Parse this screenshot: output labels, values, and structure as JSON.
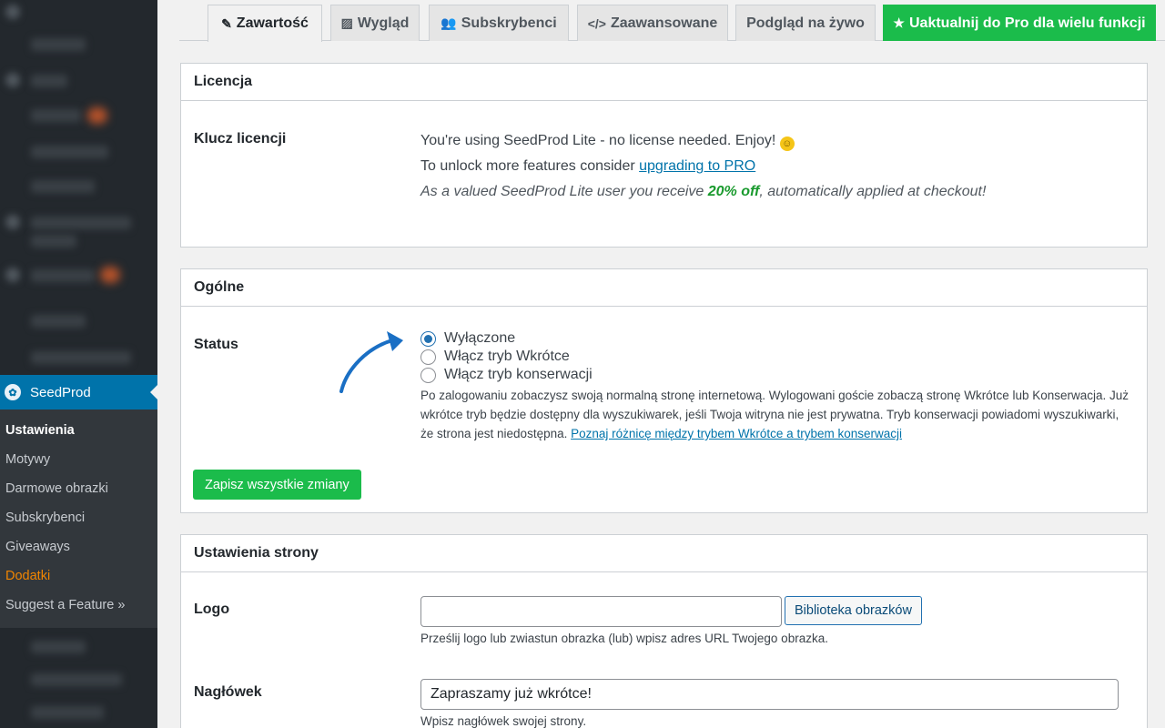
{
  "sidebar": {
    "plugin_name": "SeedProd",
    "submenu": [
      {
        "label": "Ustawienia"
      },
      {
        "label": "Motywy"
      },
      {
        "label": "Darmowe obrazki"
      },
      {
        "label": "Subskrybenci"
      },
      {
        "label": "Giveaways"
      },
      {
        "label": "Dodatki"
      },
      {
        "label": "Suggest a Feature »"
      }
    ]
  },
  "tabs": [
    {
      "label": "Zawartość",
      "icon": "edit-icon"
    },
    {
      "label": "Wygląd",
      "icon": "image-icon"
    },
    {
      "label": "Subskrybenci",
      "icon": "users-icon"
    },
    {
      "label": "Zaawansowane",
      "icon": "code-icon"
    },
    {
      "label": "Podgląd na żywo"
    },
    {
      "label": "Uaktualnij do Pro dla wielu funkcji",
      "icon": "star-icon"
    }
  ],
  "license": {
    "heading": "Licencja",
    "label": "Klucz licencji",
    "line1": "You're using SeedProd Lite - no license needed. Enjoy!",
    "line2_prefix": "To unlock more features consider ",
    "line2_link": "upgrading to PRO",
    "line3_prefix": "As a valued SeedProd Lite user you receive ",
    "line3_highlight": "20% off",
    "line3_suffix": ", automatically applied at checkout!"
  },
  "general": {
    "heading": "Ogólne",
    "status_label": "Status",
    "options": [
      {
        "label": "Wyłączone",
        "selected": true
      },
      {
        "label": "Włącz tryb Wkrótce",
        "selected": false
      },
      {
        "label": "Włącz tryb konserwacji",
        "selected": false
      }
    ],
    "description": "Po zalogowaniu zobaczysz swoją normalną stronę internetową. Wylogowani goście zobaczą stronę Wkrótce lub Konserwacja. Już wkrótce tryb będzie dostępny dla wyszukiwarek, jeśli Twoja witryna nie jest prywatna. Tryb konserwacji powiadomi wyszukiwarki, że strona jest niedostępna. ",
    "description_link": "Poznaj różnicę między trybem Wkrótce a trybem konserwacji",
    "save_label": "Zapisz wszystkie zmiany"
  },
  "page_settings": {
    "heading": "Ustawienia strony",
    "logo_label": "Logo",
    "logo_value": "",
    "media_button": "Biblioteka obrazków",
    "logo_hint": "Prześlij logo lub zwiastun obrazka (lub) wpisz adres URL Twojego obrazka.",
    "headline_label": "Nagłówek",
    "headline_value": "Zapraszamy już wkrótce!",
    "headline_hint": "Wpisz nagłówek swojej strony."
  },
  "colors": {
    "accent_green": "#1bbc4b",
    "wp_blue": "#0073aa",
    "sidebar_bg": "#23282d"
  }
}
